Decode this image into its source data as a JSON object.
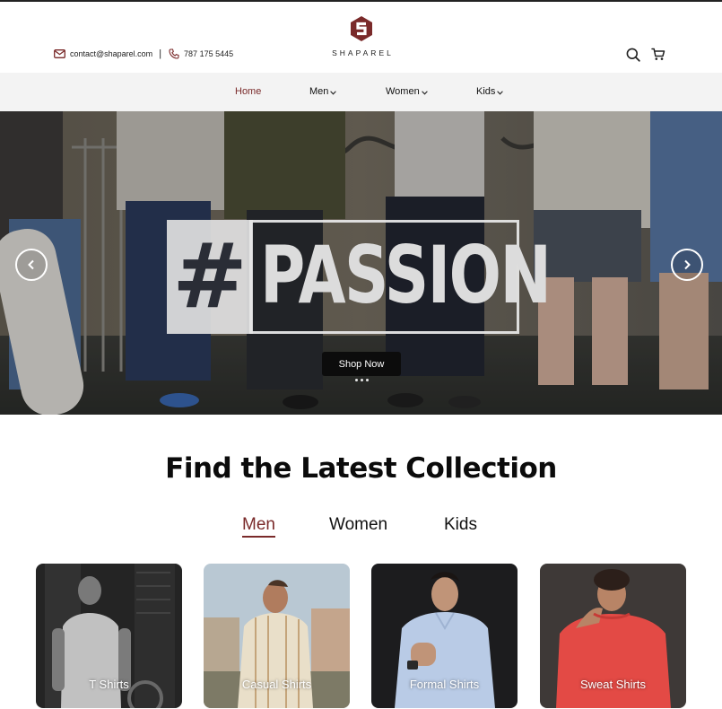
{
  "header": {
    "email": "contact@shaparel.com",
    "phone": "787 175 5445",
    "brand": "SHAPAREL",
    "icons": {
      "email": "mail-icon",
      "phone": "phone-icon",
      "search": "search-icon",
      "cart": "cart-icon"
    },
    "brand_color": "#7a2a2a"
  },
  "nav": {
    "items": [
      {
        "label": "Home",
        "active": true,
        "dropdown": false
      },
      {
        "label": "Men",
        "active": false,
        "dropdown": true
      },
      {
        "label": "Women",
        "active": false,
        "dropdown": true
      },
      {
        "label": "Kids",
        "active": false,
        "dropdown": true
      }
    ]
  },
  "hero": {
    "hashtag": "#",
    "headline": "PASSION",
    "cta_label": "Shop Now",
    "slides_count": 3
  },
  "collection": {
    "title": "Find the Latest Collection",
    "tabs": [
      {
        "label": "Men",
        "active": true
      },
      {
        "label": "Women",
        "active": false
      },
      {
        "label": "Kids",
        "active": false
      }
    ],
    "cards": [
      {
        "label": "T Shirts"
      },
      {
        "label": "Casual Shirts"
      },
      {
        "label": "Formal Shirts"
      },
      {
        "label": "Sweat Shirts"
      }
    ]
  }
}
